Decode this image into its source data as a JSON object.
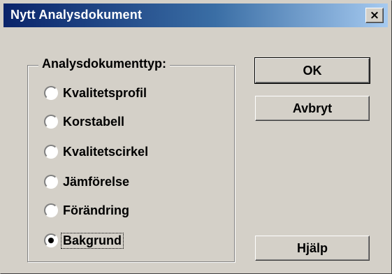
{
  "window": {
    "title": "Nytt Analysdokument",
    "close_symbol": "×"
  },
  "group": {
    "legend": "Analysdokumenttyp:",
    "options": [
      {
        "label": "Kvalitetsprofil",
        "selected": false
      },
      {
        "label": "Korstabell",
        "selected": false
      },
      {
        "label": "Kvalitetscirkel",
        "selected": false
      },
      {
        "label": "Jämförelse",
        "selected": false
      },
      {
        "label": "Förändring",
        "selected": false
      },
      {
        "label": "Bakgrund",
        "selected": true
      }
    ]
  },
  "buttons": {
    "ok": "OK",
    "cancel": "Avbryt",
    "help": "Hjälp"
  },
  "colors": {
    "title_start": "#0a246a",
    "title_end": "#a6caf0",
    "face": "#d4d0c8"
  }
}
